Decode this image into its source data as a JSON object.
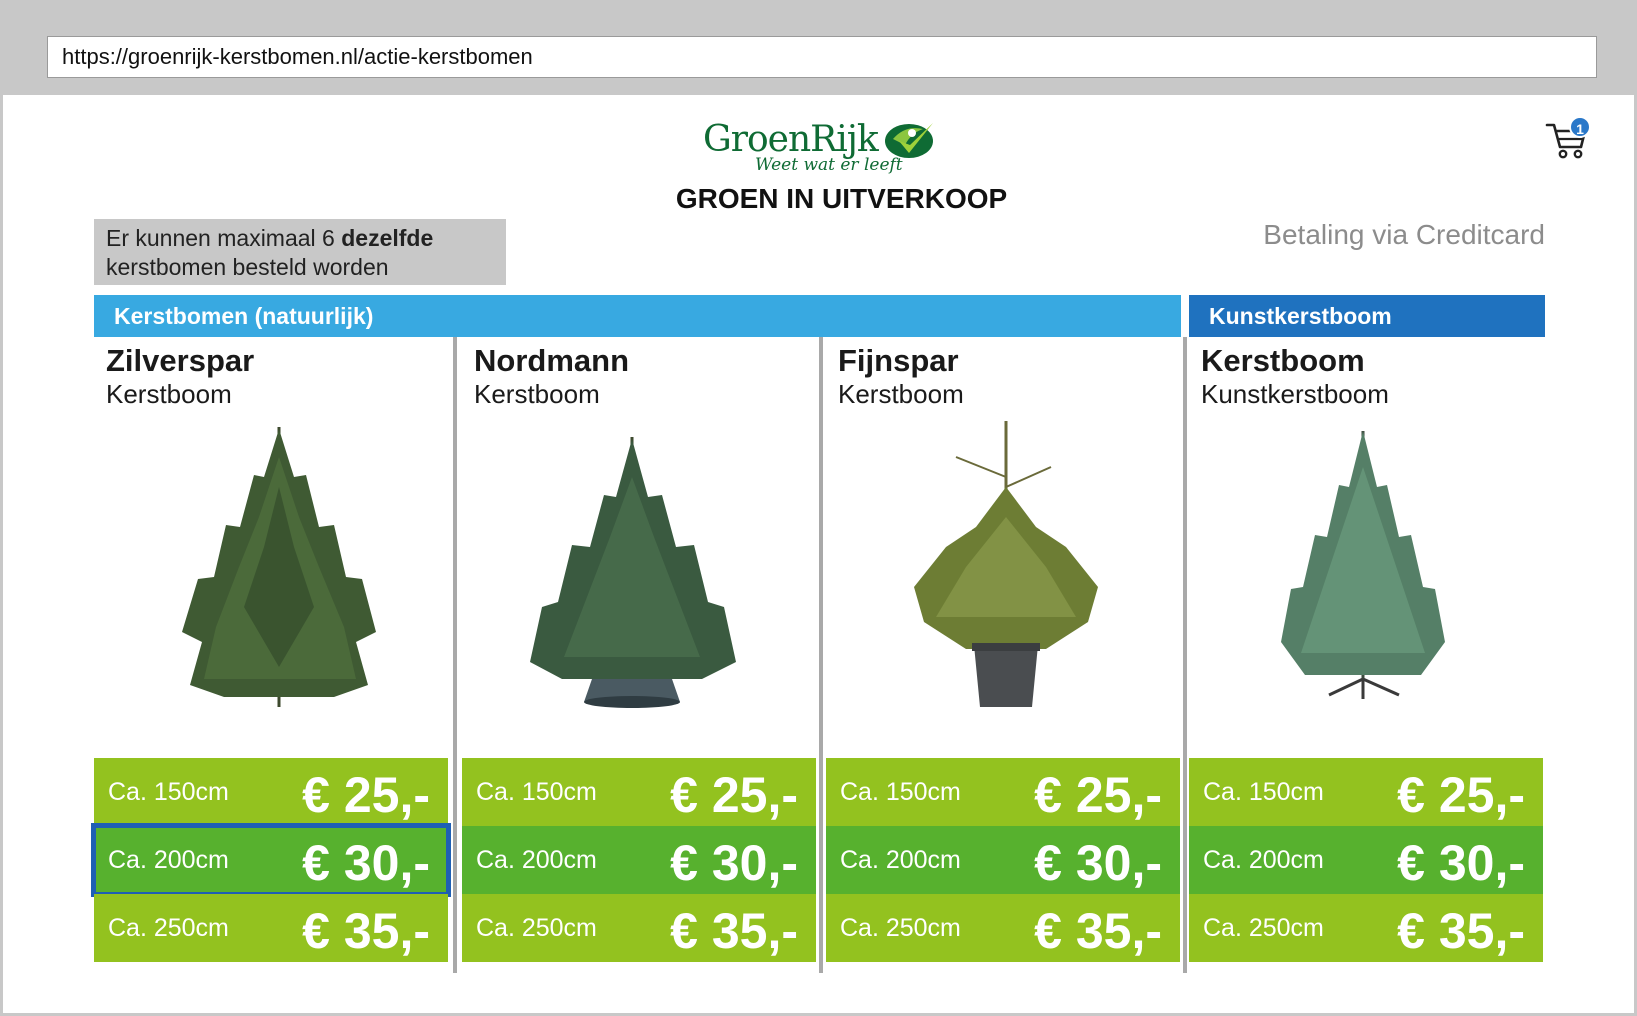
{
  "browser": {
    "url": "https://groenrijk-kerstbomen.nl/actie-kerstbomen"
  },
  "header": {
    "logo_name": "GroenRijk",
    "logo_tagline": "Weet wat er leeft",
    "title": "GROEN IN UITVERKOOP",
    "cart_count": "1",
    "cart_icon": "shopping-cart-icon"
  },
  "notice": {
    "text_before": "Er kunnen maximaal 6 ",
    "text_bold": "dezelfde",
    "text_after": " kerstbomen besteld worden"
  },
  "payment_note": "Betaling via Creditcard",
  "categories": {
    "natural": "Kerstbomen (natuurlijk)",
    "artificial": "Kunstkerstboom"
  },
  "colors": {
    "category_natural": "#38a9e1",
    "category_artificial": "#1f72bf",
    "price_light": "#93c21f",
    "price_dark": "#57b12e",
    "selection_outline": "#1e5fb4",
    "brand_green": "#0f6b34"
  },
  "products": [
    {
      "name": "Zilverspar",
      "type": "Kerstboom",
      "image_icon": "tree-image",
      "prices": [
        {
          "size": "Ca. 150cm",
          "price": "€ 25,-"
        },
        {
          "size": "Ca. 200cm",
          "price": "€ 30,-",
          "selected": true
        },
        {
          "size": "Ca. 250cm",
          "price": "€ 35,-"
        }
      ]
    },
    {
      "name": "Nordmann",
      "type": "Kerstboom",
      "image_icon": "tree-image",
      "prices": [
        {
          "size": "Ca. 150cm",
          "price": "€ 25,-"
        },
        {
          "size": "Ca. 200cm",
          "price": "€ 30,-"
        },
        {
          "size": "Ca. 250cm",
          "price": "€ 35,-"
        }
      ]
    },
    {
      "name": "Fijnspar",
      "type": "Kerstboom",
      "image_icon": "potted-tree-image",
      "prices": [
        {
          "size": "Ca. 150cm",
          "price": "€ 25,-"
        },
        {
          "size": "Ca. 200cm",
          "price": "€ 30,-"
        },
        {
          "size": "Ca. 250cm",
          "price": "€ 35,-"
        }
      ]
    },
    {
      "name": "Kerstboom",
      "type": "Kunstkerstboom",
      "image_icon": "artificial-tree-image",
      "prices": [
        {
          "size": "Ca. 150cm",
          "price": "€ 25,-"
        },
        {
          "size": "Ca. 200cm",
          "price": "€ 30,-"
        },
        {
          "size": "Ca. 250cm",
          "price": "€ 35,-"
        }
      ]
    }
  ]
}
